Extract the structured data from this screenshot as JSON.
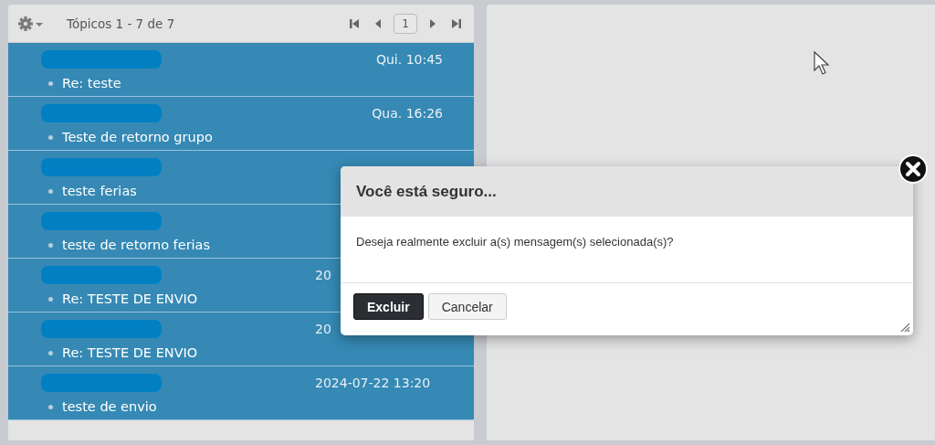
{
  "topic_list": {
    "header": {
      "count_label": "Tópicos 1 - 7 de 7",
      "page": "1"
    },
    "rows": [
      {
        "kind": "weekday",
        "date": "Qui. 10:45",
        "subject": "Re: teste",
        "selected": true
      },
      {
        "kind": "weekday",
        "date": "Qua. 16:26",
        "subject": "Teste de retorno grupo",
        "selected": true
      },
      {
        "subject": "teste ferias",
        "selected": true
      },
      {
        "subject": "teste de retorno ferias",
        "selected": true
      },
      {
        "kind": "full",
        "date": "20",
        "subject": "Re: TESTE DE ENVIO",
        "selected": true
      },
      {
        "kind": "full",
        "date": "20",
        "subject": "Re: TESTE DE ENVIO",
        "selected": true
      },
      {
        "kind": "full",
        "date": "2024-07-22 13:20",
        "subject": "teste de envio",
        "selected": true
      }
    ]
  },
  "dialog": {
    "title": "Você está seguro...",
    "message": "Deseja realmente excluir a(s) mensagem(s) selecionada(s)?",
    "buttons": [
      {
        "label": "Excluir",
        "kind": "primary"
      },
      {
        "label": "Cancelar",
        "kind": "secondary"
      }
    ]
  }
}
